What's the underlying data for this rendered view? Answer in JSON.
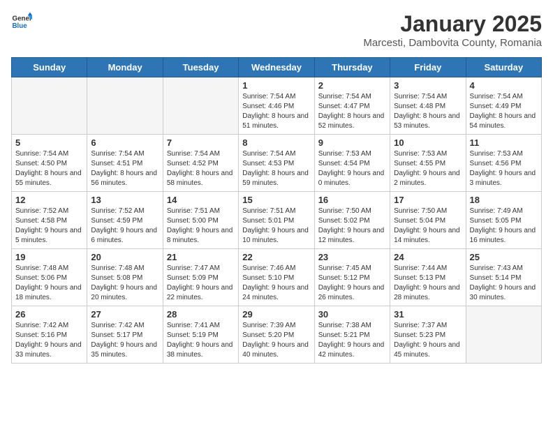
{
  "logo": {
    "general": "General",
    "blue": "Blue"
  },
  "title": "January 2025",
  "subtitle": "Marcesti, Dambovita County, Romania",
  "weekdays": [
    "Sunday",
    "Monday",
    "Tuesday",
    "Wednesday",
    "Thursday",
    "Friday",
    "Saturday"
  ],
  "weeks": [
    [
      {
        "day": "",
        "info": ""
      },
      {
        "day": "",
        "info": ""
      },
      {
        "day": "",
        "info": ""
      },
      {
        "day": "1",
        "info": "Sunrise: 7:54 AM\nSunset: 4:46 PM\nDaylight: 8 hours\nand 51 minutes."
      },
      {
        "day": "2",
        "info": "Sunrise: 7:54 AM\nSunset: 4:47 PM\nDaylight: 8 hours\nand 52 minutes."
      },
      {
        "day": "3",
        "info": "Sunrise: 7:54 AM\nSunset: 4:48 PM\nDaylight: 8 hours\nand 53 minutes."
      },
      {
        "day": "4",
        "info": "Sunrise: 7:54 AM\nSunset: 4:49 PM\nDaylight: 8 hours\nand 54 minutes."
      }
    ],
    [
      {
        "day": "5",
        "info": "Sunrise: 7:54 AM\nSunset: 4:50 PM\nDaylight: 8 hours\nand 55 minutes."
      },
      {
        "day": "6",
        "info": "Sunrise: 7:54 AM\nSunset: 4:51 PM\nDaylight: 8 hours\nand 56 minutes."
      },
      {
        "day": "7",
        "info": "Sunrise: 7:54 AM\nSunset: 4:52 PM\nDaylight: 8 hours\nand 58 minutes."
      },
      {
        "day": "8",
        "info": "Sunrise: 7:54 AM\nSunset: 4:53 PM\nDaylight: 8 hours\nand 59 minutes."
      },
      {
        "day": "9",
        "info": "Sunrise: 7:53 AM\nSunset: 4:54 PM\nDaylight: 9 hours\nand 0 minutes."
      },
      {
        "day": "10",
        "info": "Sunrise: 7:53 AM\nSunset: 4:55 PM\nDaylight: 9 hours\nand 2 minutes."
      },
      {
        "day": "11",
        "info": "Sunrise: 7:53 AM\nSunset: 4:56 PM\nDaylight: 9 hours\nand 3 minutes."
      }
    ],
    [
      {
        "day": "12",
        "info": "Sunrise: 7:52 AM\nSunset: 4:58 PM\nDaylight: 9 hours\nand 5 minutes."
      },
      {
        "day": "13",
        "info": "Sunrise: 7:52 AM\nSunset: 4:59 PM\nDaylight: 9 hours\nand 6 minutes."
      },
      {
        "day": "14",
        "info": "Sunrise: 7:51 AM\nSunset: 5:00 PM\nDaylight: 9 hours\nand 8 minutes."
      },
      {
        "day": "15",
        "info": "Sunrise: 7:51 AM\nSunset: 5:01 PM\nDaylight: 9 hours\nand 10 minutes."
      },
      {
        "day": "16",
        "info": "Sunrise: 7:50 AM\nSunset: 5:02 PM\nDaylight: 9 hours\nand 12 minutes."
      },
      {
        "day": "17",
        "info": "Sunrise: 7:50 AM\nSunset: 5:04 PM\nDaylight: 9 hours\nand 14 minutes."
      },
      {
        "day": "18",
        "info": "Sunrise: 7:49 AM\nSunset: 5:05 PM\nDaylight: 9 hours\nand 16 minutes."
      }
    ],
    [
      {
        "day": "19",
        "info": "Sunrise: 7:48 AM\nSunset: 5:06 PM\nDaylight: 9 hours\nand 18 minutes."
      },
      {
        "day": "20",
        "info": "Sunrise: 7:48 AM\nSunset: 5:08 PM\nDaylight: 9 hours\nand 20 minutes."
      },
      {
        "day": "21",
        "info": "Sunrise: 7:47 AM\nSunset: 5:09 PM\nDaylight: 9 hours\nand 22 minutes."
      },
      {
        "day": "22",
        "info": "Sunrise: 7:46 AM\nSunset: 5:10 PM\nDaylight: 9 hours\nand 24 minutes."
      },
      {
        "day": "23",
        "info": "Sunrise: 7:45 AM\nSunset: 5:12 PM\nDaylight: 9 hours\nand 26 minutes."
      },
      {
        "day": "24",
        "info": "Sunrise: 7:44 AM\nSunset: 5:13 PM\nDaylight: 9 hours\nand 28 minutes."
      },
      {
        "day": "25",
        "info": "Sunrise: 7:43 AM\nSunset: 5:14 PM\nDaylight: 9 hours\nand 30 minutes."
      }
    ],
    [
      {
        "day": "26",
        "info": "Sunrise: 7:42 AM\nSunset: 5:16 PM\nDaylight: 9 hours\nand 33 minutes."
      },
      {
        "day": "27",
        "info": "Sunrise: 7:42 AM\nSunset: 5:17 PM\nDaylight: 9 hours\nand 35 minutes."
      },
      {
        "day": "28",
        "info": "Sunrise: 7:41 AM\nSunset: 5:19 PM\nDaylight: 9 hours\nand 38 minutes."
      },
      {
        "day": "29",
        "info": "Sunrise: 7:39 AM\nSunset: 5:20 PM\nDaylight: 9 hours\nand 40 minutes."
      },
      {
        "day": "30",
        "info": "Sunrise: 7:38 AM\nSunset: 5:21 PM\nDaylight: 9 hours\nand 42 minutes."
      },
      {
        "day": "31",
        "info": "Sunrise: 7:37 AM\nSunset: 5:23 PM\nDaylight: 9 hours\nand 45 minutes."
      },
      {
        "day": "",
        "info": ""
      }
    ]
  ]
}
